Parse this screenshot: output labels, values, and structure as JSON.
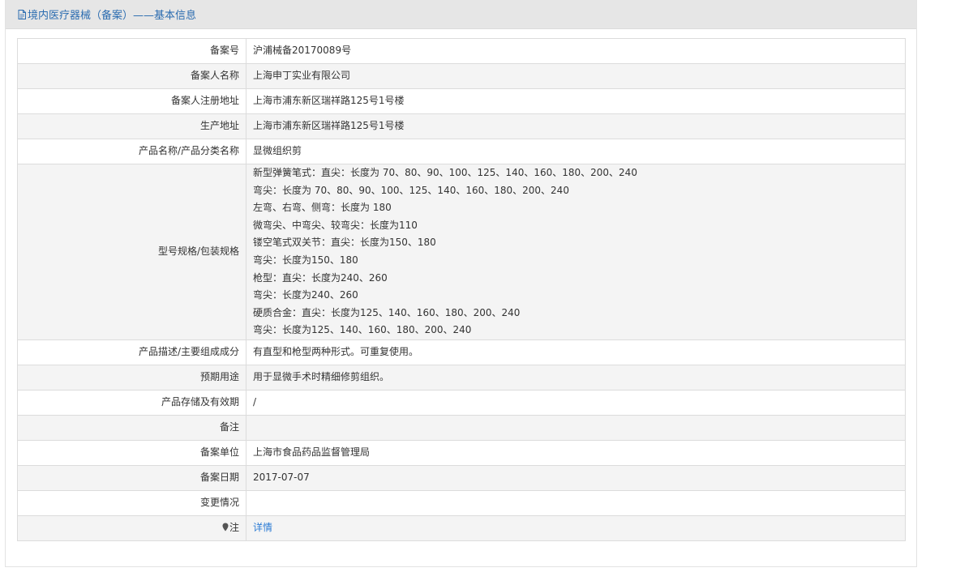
{
  "header": {
    "title": "境内医疗器械（备案）——基本信息"
  },
  "rows": [
    {
      "label": "备案号",
      "value": "沪浦械备20170089号"
    },
    {
      "label": "备案人名称",
      "value": "上海申丁实业有限公司"
    },
    {
      "label": "备案人注册地址",
      "value": "上海市浦东新区瑞祥路125号1号楼"
    },
    {
      "label": "生产地址",
      "value": "上海市浦东新区瑞祥路125号1号楼"
    },
    {
      "label": "产品名称/产品分类名称",
      "value": "显微组织剪"
    },
    {
      "label": "型号规格/包装规格",
      "lines": [
        "新型弹簧笔式：直尖：长度为 70、80、90、100、125、140、160、180、200、240",
        "弯尖：长度为 70、80、90、100、125、140、160、180、200、240",
        "左弯、右弯、侧弯：长度为 180",
        "微弯尖、中弯尖、较弯尖：长度为110",
        "镂空笔式双关节：直尖：长度为150、180",
        "弯尖：长度为150、180",
        "枪型：直尖：长度为240、260",
        "弯尖：长度为240、260",
        "硬质合金：直尖：长度为125、140、160、180、200、240",
        "弯尖：长度为125、140、160、180、200、240"
      ]
    },
    {
      "label": "产品描述/主要组成成分",
      "value": "有直型和枪型两种形式。可重复使用。"
    },
    {
      "label": "预期用途",
      "value": "用于显微手术时精细修剪组织。"
    },
    {
      "label": "产品存储及有效期",
      "value": "/"
    },
    {
      "label": "备注",
      "value": ""
    },
    {
      "label": "备案单位",
      "value": "上海市食品药品监督管理局"
    },
    {
      "label": "备案日期",
      "value": "2017-07-07"
    },
    {
      "label": "变更情况",
      "value": ""
    },
    {
      "label": "注",
      "value": "详情",
      "icon": "map-pin-icon",
      "link": true
    }
  ],
  "colors": {
    "header_bg": "#e6e6e6",
    "title_color": "#2b6cb0",
    "link_color": "#2b7bd4",
    "row_alt_bg": "#f4f4f4",
    "border": "#dcdcdc"
  }
}
